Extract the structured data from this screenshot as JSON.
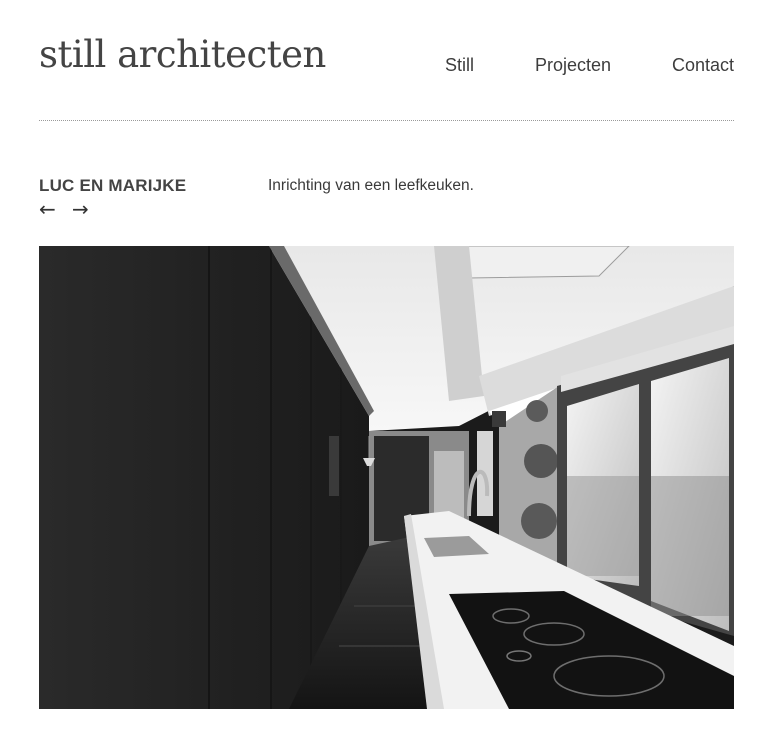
{
  "header": {
    "logo": "still architecten",
    "nav": [
      {
        "label": "Still"
      },
      {
        "label": "Projecten"
      },
      {
        "label": "Contact"
      }
    ]
  },
  "project": {
    "title": "LUC EN MARIJKE",
    "prev_icon": "arrow-left-icon",
    "next_icon": "arrow-right-icon",
    "prev_glyph": "←",
    "next_glyph": "→",
    "description": "Inrichting van een leefkeuken."
  },
  "photo": {
    "subject": "black-and-white kitchen interior photo"
  }
}
